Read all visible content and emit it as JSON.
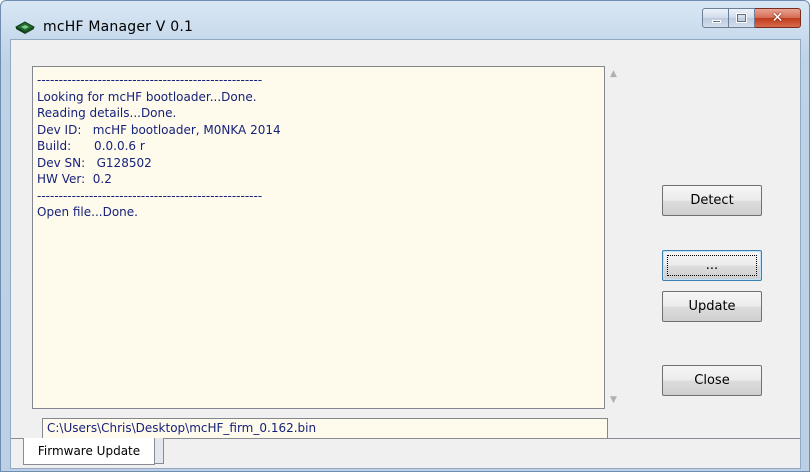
{
  "window": {
    "title": "mcHF Manager V 0.1",
    "icon": "chip-icon",
    "controls": {
      "minimize": "minimize-icon",
      "maximize": "maximize-icon",
      "close_label": "✕"
    }
  },
  "log": {
    "lines": [
      "----------------------------------------------------",
      "Looking for mcHF bootloader...Done.",
      "Reading details...Done.",
      "Dev ID:   mcHF bootloader, M0NKA 2014",
      "Build:      0.0.0.6 r",
      "Dev SN:   G128502",
      "HW Ver:  0.2",
      "----------------------------------------------------",
      "Open file...Done."
    ],
    "scroll_up_glyph": "▲",
    "scroll_down_glyph": "▼"
  },
  "path_field": {
    "value": "C:\\Users\\Chris\\Desktop\\mcHF_firm_0.162.bin"
  },
  "buttons": {
    "detect": "Detect",
    "browse": "...",
    "update": "Update",
    "close": "Close"
  },
  "tabs": [
    {
      "label": "Firmware Update",
      "active": true
    }
  ],
  "colors": {
    "log_text": "#17227a",
    "log_bg": "#fefbed",
    "focus_border": "#3c7fb1"
  }
}
